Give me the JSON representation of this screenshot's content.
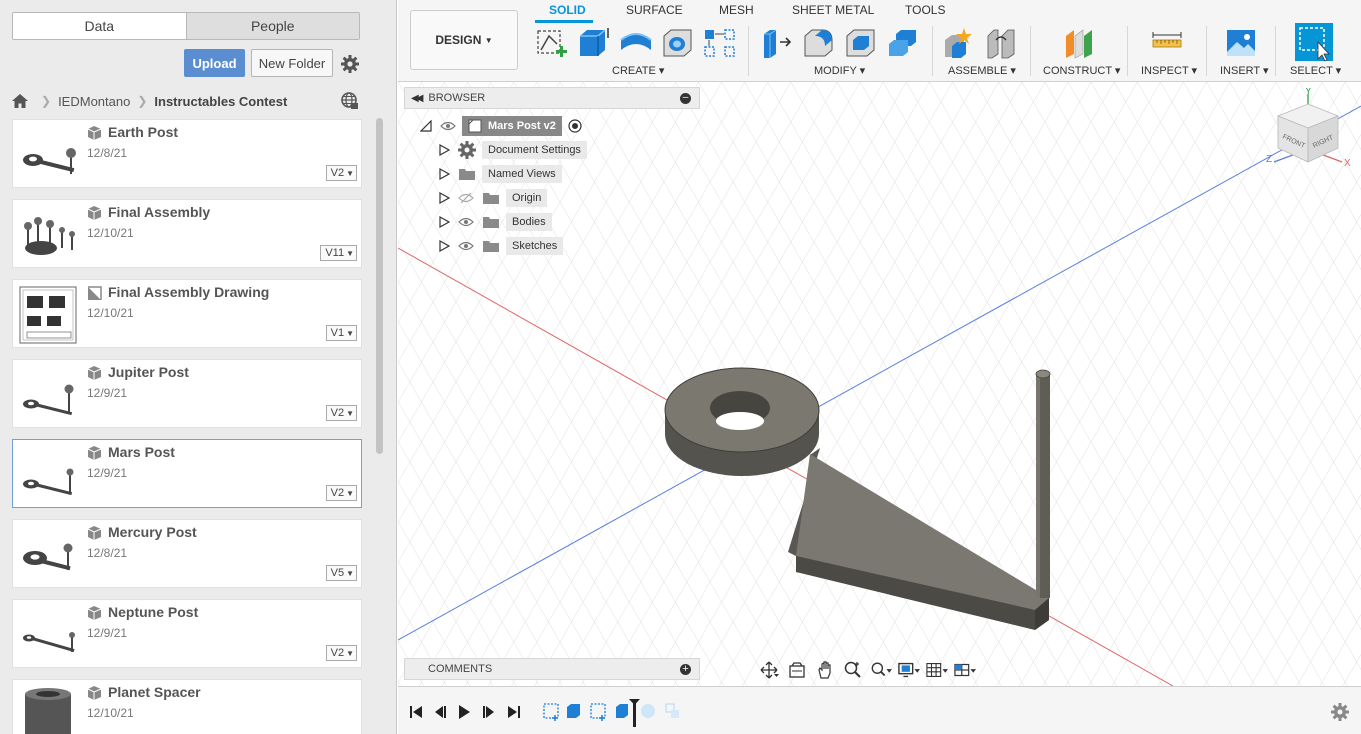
{
  "data_panel": {
    "tabs": [
      "Data",
      "People"
    ],
    "upload_label": "Upload",
    "new_folder_label": "New Folder",
    "breadcrumb": [
      "IEDMontano",
      "Instructables Contest"
    ],
    "files": [
      {
        "name": "Earth Post",
        "date": "12/8/21",
        "version": "V2",
        "type": "design"
      },
      {
        "name": "Final Assembly",
        "date": "12/10/21",
        "version": "V11",
        "type": "design"
      },
      {
        "name": "Final Assembly Drawing",
        "date": "12/10/21",
        "version": "V1",
        "type": "drawing"
      },
      {
        "name": "Jupiter Post",
        "date": "12/9/21",
        "version": "V2",
        "type": "design"
      },
      {
        "name": "Mars Post",
        "date": "12/9/21",
        "version": "V2",
        "type": "design",
        "selected": true
      },
      {
        "name": "Mercury Post",
        "date": "12/8/21",
        "version": "V5",
        "type": "design"
      },
      {
        "name": "Neptune Post",
        "date": "12/9/21",
        "version": "V2",
        "type": "design"
      },
      {
        "name": "Planet Spacer",
        "date": "12/10/21",
        "version": "",
        "type": "design"
      }
    ]
  },
  "toolbar": {
    "workspace": "DESIGN",
    "tabs": [
      "SOLID",
      "SURFACE",
      "MESH",
      "SHEET METAL",
      "TOOLS"
    ],
    "active_tab": "SOLID",
    "groups": [
      "CREATE",
      "MODIFY",
      "ASSEMBLE",
      "CONSTRUCT",
      "INSPECT",
      "INSERT",
      "SELECT"
    ]
  },
  "browser": {
    "title": "BROWSER",
    "root": "Mars Post v2",
    "items": [
      "Document Settings",
      "Named Views",
      "Origin",
      "Bodies",
      "Sketches"
    ]
  },
  "viewcube": {
    "faces": [
      "FRONT",
      "RIGHT"
    ],
    "axes": [
      "Y",
      "Z",
      "X"
    ]
  },
  "comments_label": "COMMENTS",
  "colors": {
    "accent": "#0696d7",
    "upload": "#5b8ed0",
    "model": "#6e6c64"
  }
}
